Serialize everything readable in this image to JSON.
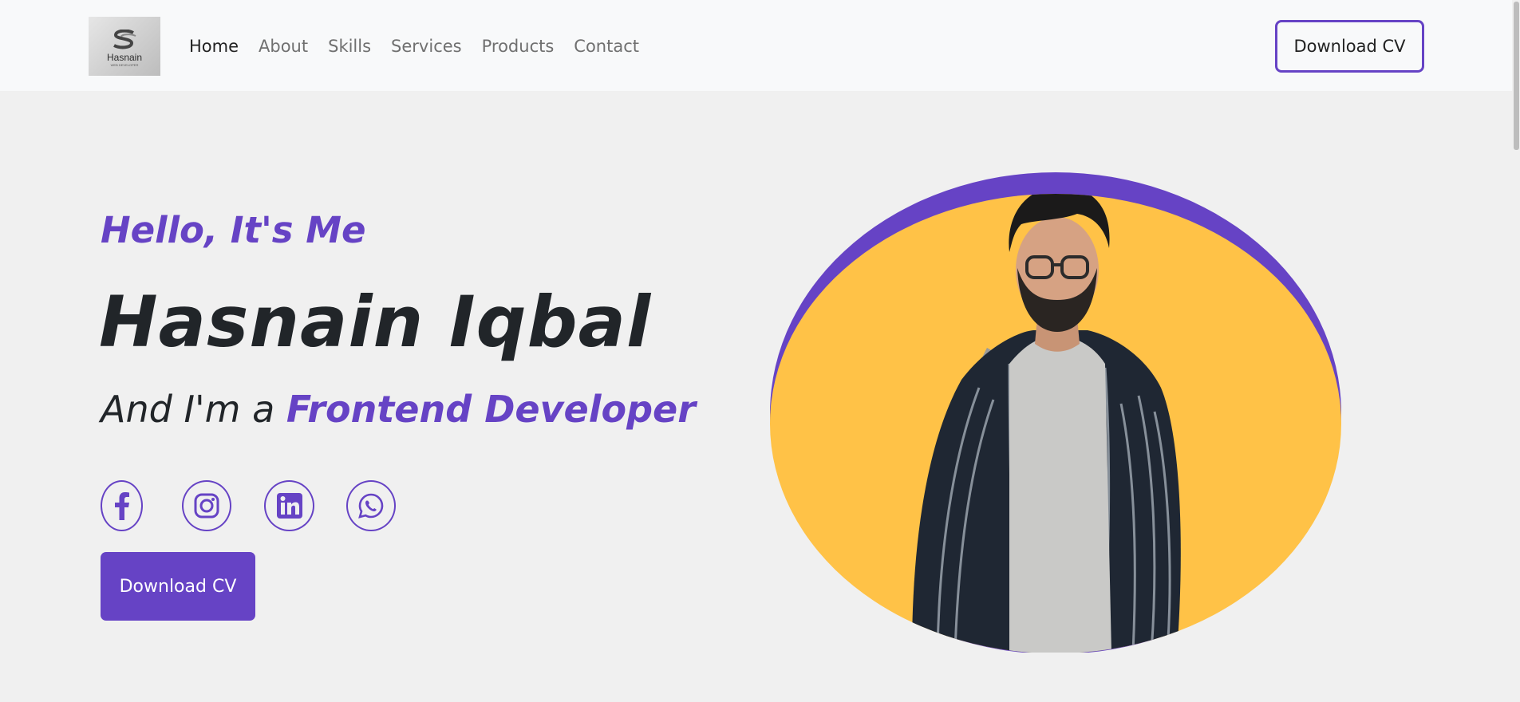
{
  "header": {
    "logo": {
      "text": "Hasnain",
      "subtext": "WEB DEVELOPER",
      "icon": "s-monogram-logo"
    },
    "nav": [
      {
        "label": "Home",
        "active": true
      },
      {
        "label": "About",
        "active": false
      },
      {
        "label": "Skills",
        "active": false
      },
      {
        "label": "Services",
        "active": false
      },
      {
        "label": "Products",
        "active": false
      },
      {
        "label": "Contact",
        "active": false
      }
    ],
    "cta_label": "Download CV"
  },
  "hero": {
    "greeting": "Hello, It's Me",
    "name": "Hasnain Iqbal",
    "role_prefix": "And I'm a ",
    "role_highlight": "Frontend Developer",
    "socials": [
      {
        "icon": "facebook-icon"
      },
      {
        "icon": "instagram-icon"
      },
      {
        "icon": "linkedin-icon"
      },
      {
        "icon": "whatsapp-icon"
      }
    ],
    "cta_label": "Download CV",
    "portrait_icon": "profile-photo"
  },
  "colors": {
    "accent": "#6643c5",
    "portrait_bg": "#ffc247",
    "page_bg": "#f0f0f0",
    "navbar_bg": "#f8f9fa",
    "text_dark": "#212529"
  }
}
